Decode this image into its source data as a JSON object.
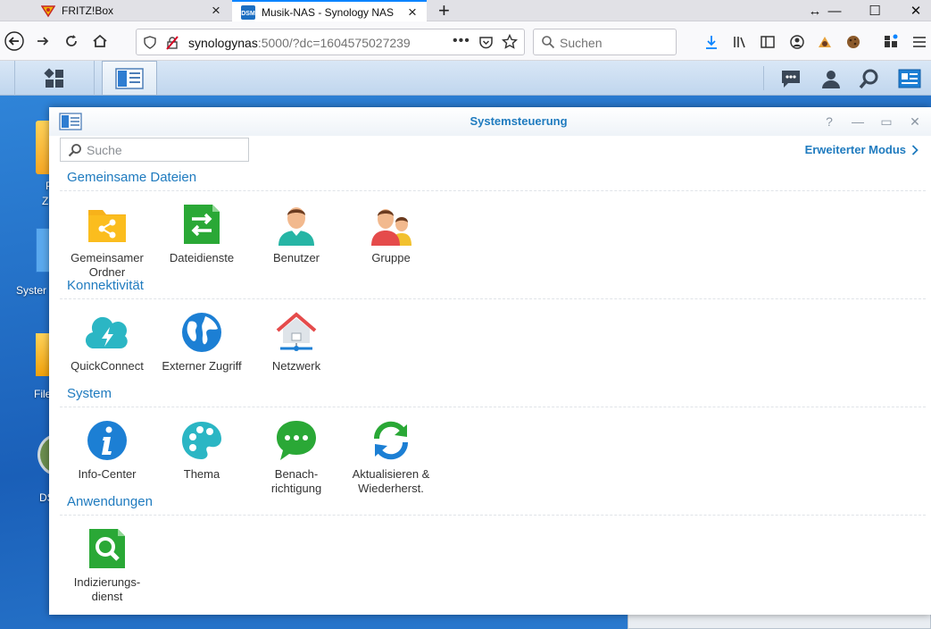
{
  "browser": {
    "tabs": [
      {
        "title": "FRITZ!Box",
        "icon": "fritzbox-icon",
        "active": false
      },
      {
        "title": "Musik-NAS - Synology NAS",
        "icon": "dsm-icon",
        "active": true
      }
    ],
    "url_host": "synologynas",
    "url_rest": ":5000/?dc=1604575027239",
    "search_placeholder": "Suchen",
    "tab_favicon_text": "DSM"
  },
  "desktop": {
    "labels": [
      "P",
      "Z",
      "Syster",
      "File",
      "DS"
    ]
  },
  "control_panel": {
    "title": "Systemsteuerung",
    "search_placeholder": "Suche",
    "advanced_mode": "Erweiterter Modus",
    "sections": [
      {
        "title": "Gemeinsame Dateien",
        "items": [
          {
            "label": "Gemeinsamer\nOrdner",
            "icon": "shared-folder-icon"
          },
          {
            "label": "Dateidienste",
            "icon": "file-services-icon"
          },
          {
            "label": "Benutzer",
            "icon": "user-icon"
          },
          {
            "label": "Gruppe",
            "icon": "group-icon"
          }
        ]
      },
      {
        "title": "Konnektivität",
        "items": [
          {
            "label": "QuickConnect",
            "icon": "quickconnect-icon"
          },
          {
            "label": "Externer Zugriff",
            "icon": "globe-icon"
          },
          {
            "label": "Netzwerk",
            "icon": "network-house-icon"
          }
        ]
      },
      {
        "title": "System",
        "items": [
          {
            "label": "Info-Center",
            "icon": "info-icon"
          },
          {
            "label": "Thema",
            "icon": "palette-icon"
          },
          {
            "label": "Benach-\nrichtigung",
            "icon": "chat-bubble-icon"
          },
          {
            "label": "Aktualisieren &\nWiederherst.",
            "icon": "refresh-icon"
          }
        ]
      },
      {
        "title": "Anwendungen",
        "items": [
          {
            "label": "Indizierungs-\ndienst",
            "icon": "indexing-search-icon"
          }
        ]
      }
    ]
  },
  "colors": {
    "accent": "#1f7bbf",
    "orange": "#f5a623",
    "green": "#2aa836",
    "teal": "#2bb6c4",
    "blue": "#1c7fd4"
  }
}
